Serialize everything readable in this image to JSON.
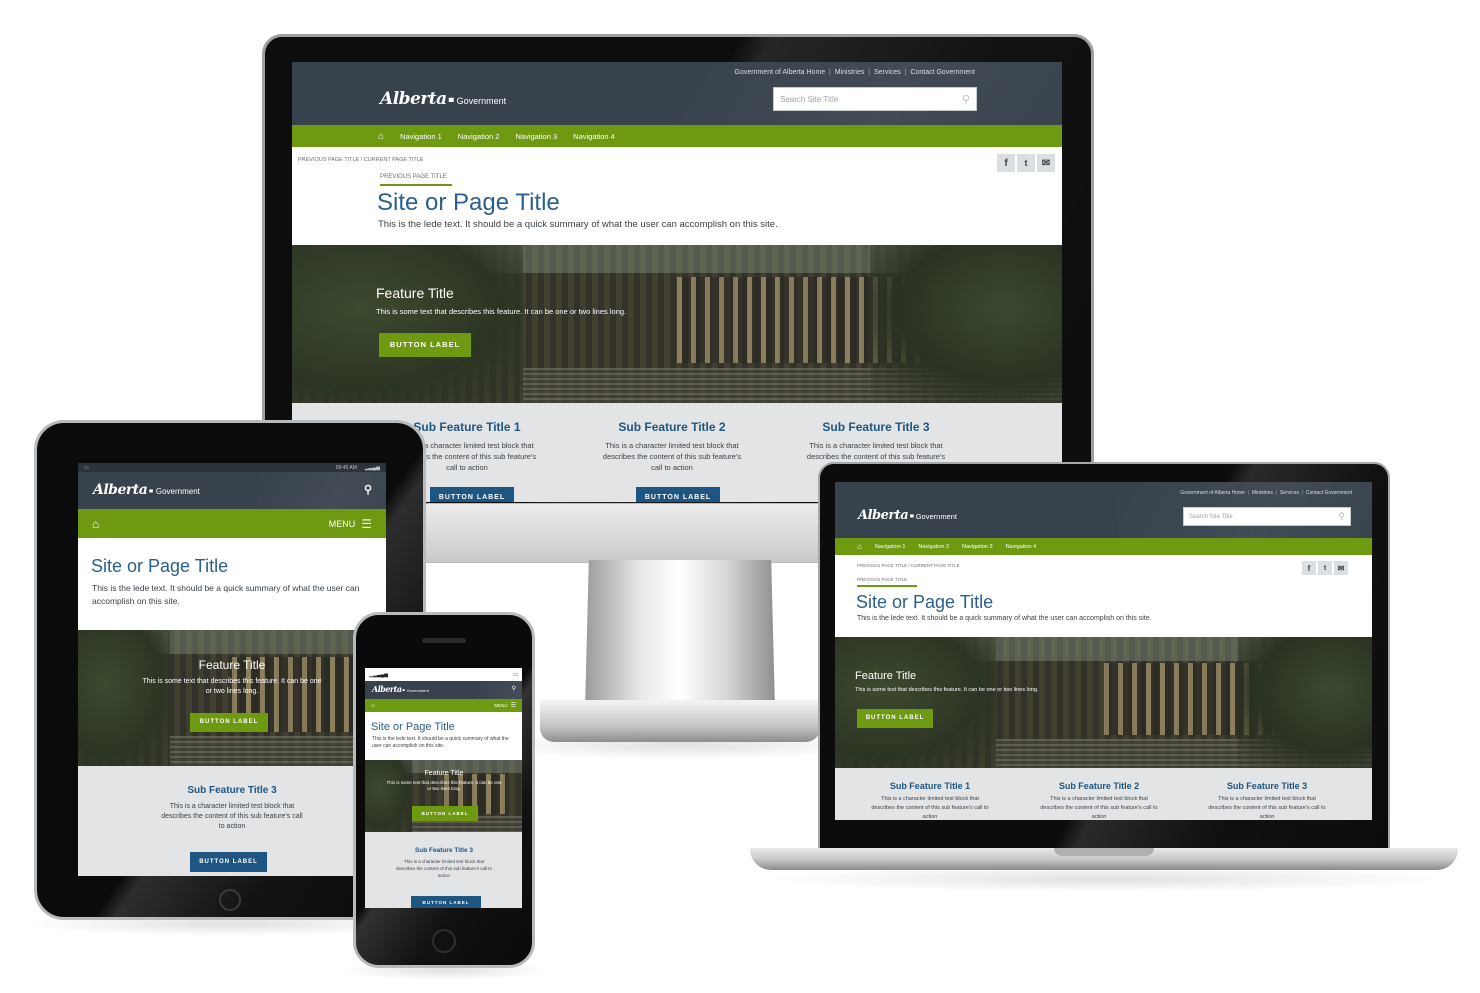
{
  "site": {
    "utility_links": [
      "Government of Alberta Home",
      "Ministries",
      "Services",
      "Contact Government"
    ],
    "logo_script": "Alberta",
    "logo_suffix": "Government",
    "search_placeholder": "Search Site Title",
    "nav_items": [
      "Navigation 1",
      "Navigation 2",
      "Navigation 3",
      "Navigation 4"
    ],
    "breadcrumb_previous": "PREVIOUS PAGE TITLE",
    "breadcrumb_separator": "/",
    "breadcrumb_current": "CURRENT PAGE TITLE",
    "previous_page_label": "PREVIOUS PAGE TITLE",
    "page_title": "Site or Page Title",
    "lede": "This is the lede text. It should be a quick summary of what the user can accomplish on this site.",
    "feature_title": "Feature Title",
    "feature_text": "This is some text that describes this feature. It can be one or two lines long.",
    "button_label": "BUTTON LABEL",
    "sub_features": [
      {
        "title": "Sub Feature Title 1",
        "text": "This is a character limited test block that describes the content of this sub feature's call to action"
      },
      {
        "title": "Sub Feature Title 2",
        "text": "This is a character limited test block that describes the content of this sub feature's call to action"
      },
      {
        "title": "Sub Feature Title 3",
        "text": "This is a character limited test block that describes the content of this sub feature's call to action"
      }
    ],
    "menu_label": "MENU",
    "tablet_time": "09:45 AM",
    "colors": {
      "header": "#38424c",
      "nav_green": "#6e9a12",
      "title_blue": "#2b5f8c",
      "button_blue": "#1f5681",
      "sub_bg": "#e2e4e6"
    }
  },
  "icons": [
    "home-icon",
    "search-icon",
    "facebook-icon",
    "twitter-icon",
    "email-icon",
    "menu-icon",
    "signal-icon",
    "battery-icon"
  ]
}
